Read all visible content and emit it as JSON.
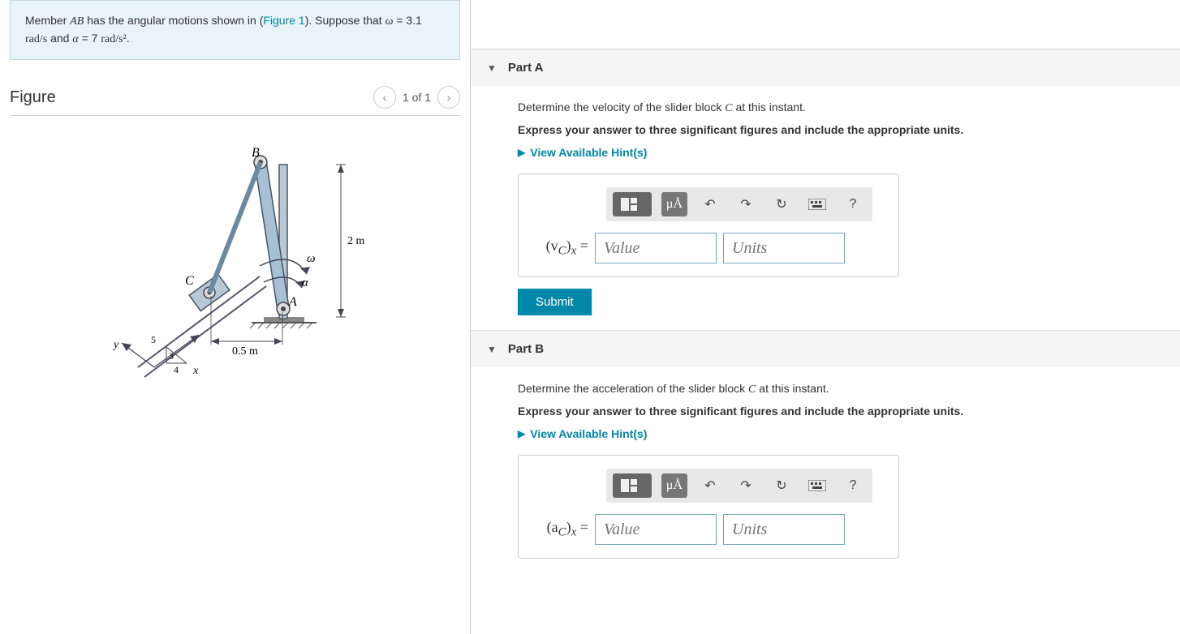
{
  "problem": {
    "text_prefix": "Member ",
    "member": "AB",
    "text_mid1": " has the angular motions shown in (",
    "figure_link": "Figure 1",
    "text_mid2": "). Suppose that ",
    "omega_var": "ω",
    "omega_eq": " = 3.1 ",
    "omega_unit": "rad/s",
    "text_and": " and ",
    "alpha_var": "α",
    "alpha_eq": " = 7 ",
    "alpha_unit": "rad/s²",
    "text_end": "."
  },
  "figure": {
    "title": "Figure",
    "nav_text": "1 of 1",
    "labels": {
      "B": "B",
      "C": "C",
      "A": "A",
      "omega": "ω",
      "alpha": "α",
      "dim1": "2 m",
      "dim2": "0.5 m",
      "y": "y",
      "x": "x",
      "five": "5",
      "three": "3",
      "four": "4"
    }
  },
  "partA": {
    "title": "Part A",
    "prompt_prefix": "Determine the velocity of the slider block ",
    "prompt_var": "C",
    "prompt_suffix": " at this instant.",
    "instruction": "Express your answer to three significant figures and include the appropriate units.",
    "hints": "View Available Hint(s)",
    "label_prefix": "(v",
    "label_sub": "C",
    "label_suffix": ")",
    "label_axis": "x",
    "label_eq": " = ",
    "value_placeholder": "Value",
    "units_placeholder": "Units",
    "submit": "Submit",
    "units_btn": "μÅ",
    "help": "?"
  },
  "partB": {
    "title": "Part B",
    "prompt_prefix": "Determine the acceleration of the slider block ",
    "prompt_var": "C",
    "prompt_suffix": " at this instant.",
    "instruction": "Express your answer to three significant figures and include the appropriate units.",
    "hints": "View Available Hint(s)",
    "label_prefix": "(a",
    "label_sub": "C",
    "label_suffix": ")",
    "label_axis": "x",
    "label_eq": " = ",
    "value_placeholder": "Value",
    "units_placeholder": "Units",
    "units_btn": "μÅ",
    "help": "?"
  }
}
